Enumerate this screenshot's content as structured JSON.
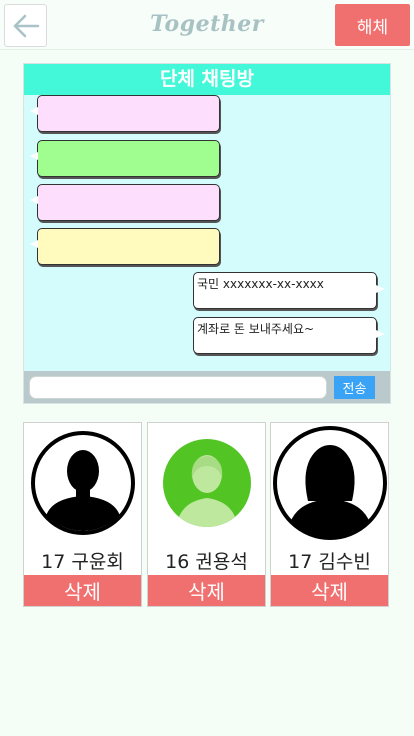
{
  "header": {
    "back_icon": "arrow-left-icon",
    "title": "Together",
    "dissolve_label": "해체"
  },
  "chat": {
    "title": "단체 채팅방",
    "incoming": [
      {
        "text": "",
        "color": "#fddffd"
      },
      {
        "text": "",
        "color": "#9ffe8f"
      },
      {
        "text": "",
        "color": "#fddffd"
      },
      {
        "text": "",
        "color": "#fffabd"
      }
    ],
    "outgoing": [
      {
        "text": "국민 xxxxxxx-xx-xxxx"
      },
      {
        "text": "계좌로 돈 보내주세요~"
      }
    ],
    "input_value": "",
    "send_label": "전송"
  },
  "members": [
    {
      "name": "17 구윤회",
      "avatar_icon": "male-silhouette-icon",
      "remove_label": "삭제"
    },
    {
      "name": "16 권용석",
      "avatar_icon": "green-person-icon",
      "remove_label": "삭제"
    },
    {
      "name": "17 김수빈",
      "avatar_icon": "female-silhouette-icon",
      "remove_label": "삭제"
    }
  ],
  "colors": {
    "accent_red": "#f06f6f",
    "chat_header": "#43f7d9",
    "chat_bg": "#d4fcfc",
    "send_blue": "#3aa3f5"
  }
}
